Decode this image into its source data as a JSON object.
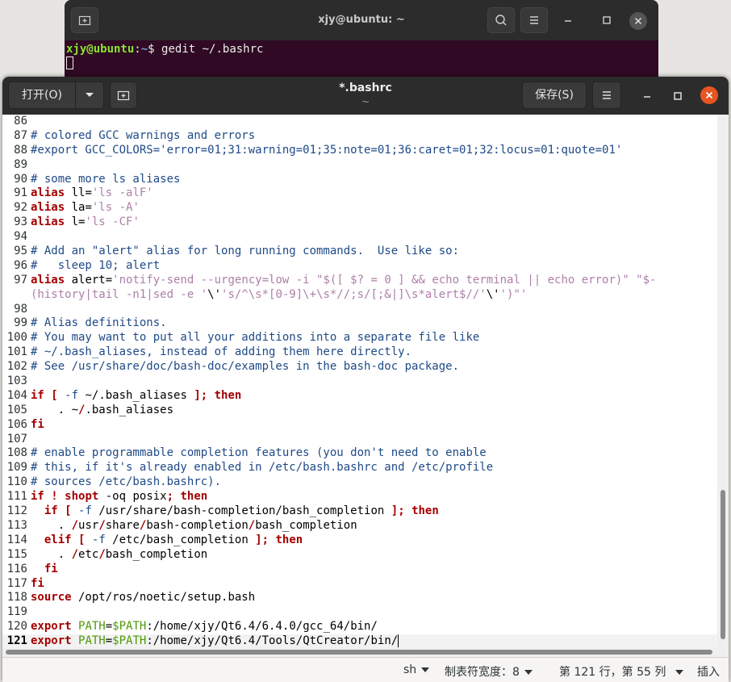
{
  "terminal": {
    "title": "xjy@ubuntu: ~",
    "prompt_user": "xjy@ubuntu",
    "prompt_sep": ":",
    "prompt_path": "~",
    "prompt_dollar": "$ ",
    "command": "gedit ~/.bashrc"
  },
  "gedit": {
    "open_label": "打开(O)",
    "title": "*.bashrc",
    "subtitle": "~",
    "save_label": "保存(S)"
  },
  "editor": {
    "lines": [
      {
        "n": "86",
        "t": [
          [
            "",
            ""
          ]
        ]
      },
      {
        "n": "87",
        "t": [
          [
            "c-cm",
            "# colored GCC warnings and errors"
          ]
        ]
      },
      {
        "n": "88",
        "t": [
          [
            "c-cm",
            "#export GCC_COLORS='error=01;31:warning=01;35:note=01;36:caret=01;32:locus=01:quote=01'"
          ]
        ]
      },
      {
        "n": "89",
        "t": [
          [
            "",
            ""
          ]
        ]
      },
      {
        "n": "90",
        "t": [
          [
            "c-cm",
            "# some more ls aliases"
          ]
        ]
      },
      {
        "n": "91",
        "t": [
          [
            "c-kw",
            "alias"
          ],
          [
            "",
            " ll="
          ],
          [
            "c-str",
            "'ls -alF'"
          ]
        ]
      },
      {
        "n": "92",
        "t": [
          [
            "c-kw",
            "alias"
          ],
          [
            "",
            " la="
          ],
          [
            "c-str",
            "'ls -A'"
          ]
        ]
      },
      {
        "n": "93",
        "t": [
          [
            "c-kw",
            "alias"
          ],
          [
            "",
            " l="
          ],
          [
            "c-str",
            "'ls -CF'"
          ]
        ]
      },
      {
        "n": "94",
        "t": [
          [
            "",
            ""
          ]
        ]
      },
      {
        "n": "95",
        "t": [
          [
            "c-cm",
            "# Add an \"alert\" alias for long running commands.  Use like so:"
          ]
        ]
      },
      {
        "n": "96",
        "t": [
          [
            "c-cm",
            "#   sleep 10; alert"
          ]
        ]
      },
      {
        "n": "97",
        "t": [
          [
            "c-kw",
            "alias"
          ],
          [
            "",
            " alert="
          ],
          [
            "c-str",
            "'notify-send --urgency=low -i \"$([ $? = 0 ] && echo terminal || echo error)\" \"$-"
          ]
        ]
      },
      {
        "n": "",
        "t": [
          [
            "c-str",
            "(history|tail -n1|sed -e '"
          ],
          [
            "",
            "\\'"
          ],
          [
            "c-str",
            "'s/^\\s*[0-9]\\+\\s*//;s/[;&|]\\s*alert$//'"
          ],
          [
            "",
            "\\'"
          ],
          [
            "c-str",
            "')\"'"
          ]
        ]
      },
      {
        "n": "98",
        "t": [
          [
            "",
            ""
          ]
        ]
      },
      {
        "n": "99",
        "t": [
          [
            "c-cm",
            "# Alias definitions."
          ]
        ]
      },
      {
        "n": "100",
        "t": [
          [
            "c-cm",
            "# You may want to put all your additions into a separate file like"
          ]
        ]
      },
      {
        "n": "101",
        "t": [
          [
            "c-cm",
            "# ~/.bash_aliases, instead of adding them here directly."
          ]
        ]
      },
      {
        "n": "102",
        "t": [
          [
            "c-cm",
            "# See /usr/share/doc/bash-doc/examples in the bash-doc package."
          ]
        ]
      },
      {
        "n": "103",
        "t": [
          [
            "",
            ""
          ]
        ]
      },
      {
        "n": "104",
        "t": [
          [
            "c-kw",
            "if"
          ],
          [
            "",
            " "
          ],
          [
            "c-op",
            "["
          ],
          [
            "",
            " "
          ],
          [
            "c-cm",
            "-f"
          ],
          [
            "",
            " ~/.bash_aliases "
          ],
          [
            "c-op",
            "];"
          ],
          [
            "",
            " "
          ],
          [
            "c-kw",
            "then"
          ]
        ]
      },
      {
        "n": "105",
        "t": [
          [
            "",
            "    . ~"
          ],
          [
            "c-op",
            "/"
          ],
          [
            "",
            ".bash_aliases"
          ]
        ]
      },
      {
        "n": "106",
        "t": [
          [
            "c-kw",
            "fi"
          ]
        ]
      },
      {
        "n": "107",
        "t": [
          [
            "",
            ""
          ]
        ]
      },
      {
        "n": "108",
        "t": [
          [
            "c-cm",
            "# enable programmable completion features (you don't need to enable"
          ]
        ]
      },
      {
        "n": "109",
        "t": [
          [
            "c-cm",
            "# this, if it's already enabled in /etc/bash.bashrc and /etc/profile"
          ]
        ]
      },
      {
        "n": "110",
        "t": [
          [
            "c-cm",
            "# sources /etc/bash.bashrc)."
          ]
        ]
      },
      {
        "n": "111",
        "t": [
          [
            "c-kw",
            "if"
          ],
          [
            "",
            " "
          ],
          [
            "c-op",
            "!"
          ],
          [
            "",
            " "
          ],
          [
            "c-kw",
            "shopt"
          ],
          [
            "",
            " -oq posix"
          ],
          [
            "c-op",
            ";"
          ],
          [
            "",
            " "
          ],
          [
            "c-kw",
            "then"
          ]
        ]
      },
      {
        "n": "112",
        "t": [
          [
            "",
            "  "
          ],
          [
            "c-kw",
            "if"
          ],
          [
            "",
            " "
          ],
          [
            "c-op",
            "["
          ],
          [
            "",
            " "
          ],
          [
            "c-cm",
            "-f"
          ],
          [
            "",
            " /usr/share/bash-completion/bash_completion "
          ],
          [
            "c-op",
            "];"
          ],
          [
            "",
            " "
          ],
          [
            "c-kw",
            "then"
          ]
        ]
      },
      {
        "n": "113",
        "t": [
          [
            "",
            "    . "
          ],
          [
            "c-op",
            "/"
          ],
          [
            "",
            "usr"
          ],
          [
            "c-op",
            "/"
          ],
          [
            "",
            "share"
          ],
          [
            "c-op",
            "/"
          ],
          [
            "",
            "bash-completion"
          ],
          [
            "c-op",
            "/"
          ],
          [
            "",
            "bash_completion"
          ]
        ]
      },
      {
        "n": "114",
        "t": [
          [
            "",
            "  "
          ],
          [
            "c-kw",
            "elif"
          ],
          [
            "",
            " "
          ],
          [
            "c-op",
            "["
          ],
          [
            "",
            " "
          ],
          [
            "c-cm",
            "-f"
          ],
          [
            "",
            " /etc/bash_completion "
          ],
          [
            "c-op",
            "];"
          ],
          [
            "",
            " "
          ],
          [
            "c-kw",
            "then"
          ]
        ]
      },
      {
        "n": "115",
        "t": [
          [
            "",
            "    . "
          ],
          [
            "c-op",
            "/"
          ],
          [
            "",
            "etc"
          ],
          [
            "c-op",
            "/"
          ],
          [
            "",
            "bash_completion"
          ]
        ]
      },
      {
        "n": "116",
        "t": [
          [
            "",
            "  "
          ],
          [
            "c-kw",
            "fi"
          ]
        ]
      },
      {
        "n": "117",
        "t": [
          [
            "c-kw",
            "fi"
          ]
        ]
      },
      {
        "n": "118",
        "t": [
          [
            "c-kw",
            "source"
          ],
          [
            "",
            " /opt/ros/noetic/setup.bash"
          ]
        ]
      },
      {
        "n": "119",
        "t": [
          [
            "",
            ""
          ]
        ]
      },
      {
        "n": "120",
        "t": [
          [
            "c-kw",
            "export"
          ],
          [
            "",
            " "
          ],
          [
            "c-var",
            "PATH"
          ],
          [
            "",
            "="
          ],
          [
            "c-var",
            "$PATH"
          ],
          [
            "",
            ":/home/xjy/Qt6.4/6.4.0/gcc_64/bin/"
          ]
        ]
      },
      {
        "n": "121",
        "t": [
          [
            "c-kw",
            "export"
          ],
          [
            "",
            " "
          ],
          [
            "c-var",
            "PATH"
          ],
          [
            "",
            "="
          ],
          [
            "c-var",
            "$PATH"
          ],
          [
            "",
            ":/home/xjy/Qt6.4/Tools/QtCreator/bin/"
          ]
        ],
        "current": true
      }
    ]
  },
  "status": {
    "language": "sh",
    "tab_width": "制表符宽度：8",
    "position": "第 121 行，第 55 列",
    "mode": "插入"
  },
  "colors": {
    "accent_close": "#e95420",
    "terminal_bg": "#300a24",
    "header_bg": "#2c2c2c"
  }
}
